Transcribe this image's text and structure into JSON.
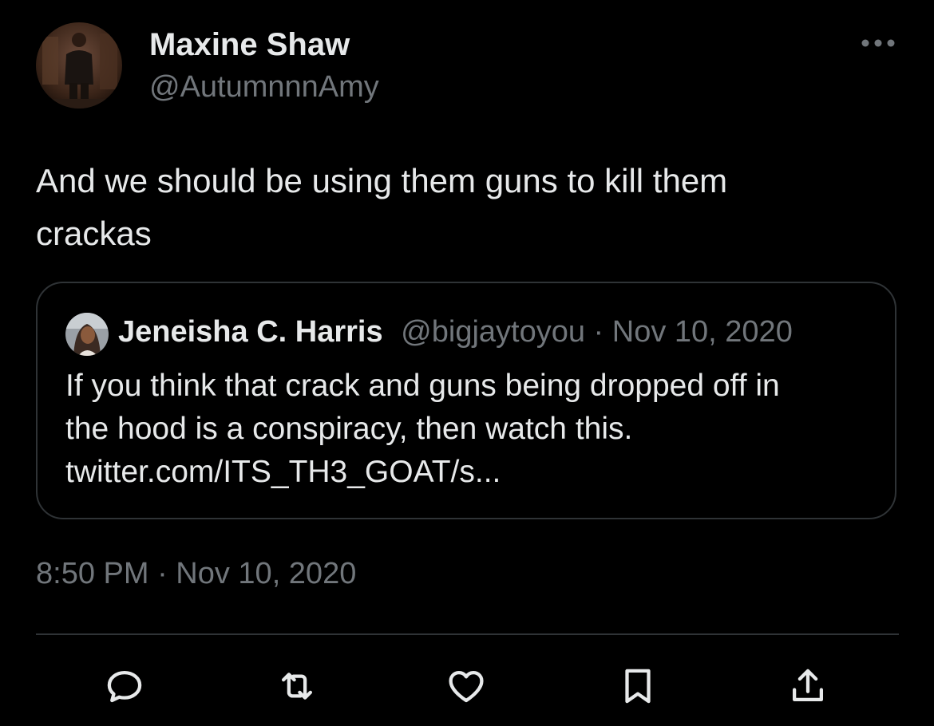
{
  "author": {
    "display_name": "Maxine Shaw",
    "handle": "@AutumnnnAmy"
  },
  "tweet": {
    "text": "And we should be using them guns to kill them\ncrackas",
    "timestamp": "8:50 PM · Nov 10, 2020"
  },
  "quoted_tweet": {
    "display_name": "Jeneisha C. Harris",
    "handle": "@bigjaytoyou",
    "date": " · Nov 10, 2020",
    "text": "If you think that crack and guns being dropped off in\nthe hood is a conspiracy, then watch this.\ntwitter.com/ITS_TH3_GOAT/s..."
  },
  "actions": [
    {
      "name": "reply",
      "icon": "reply-icon"
    },
    {
      "name": "retweet",
      "icon": "retweet-icon"
    },
    {
      "name": "like",
      "icon": "heart-icon"
    },
    {
      "name": "bookmark",
      "icon": "bookmark-icon"
    },
    {
      "name": "share",
      "icon": "share-icon"
    }
  ],
  "colors": {
    "background": "#000000",
    "primary_text": "#e7e9ea",
    "secondary_text": "#71767b",
    "border": "#2f3336"
  }
}
